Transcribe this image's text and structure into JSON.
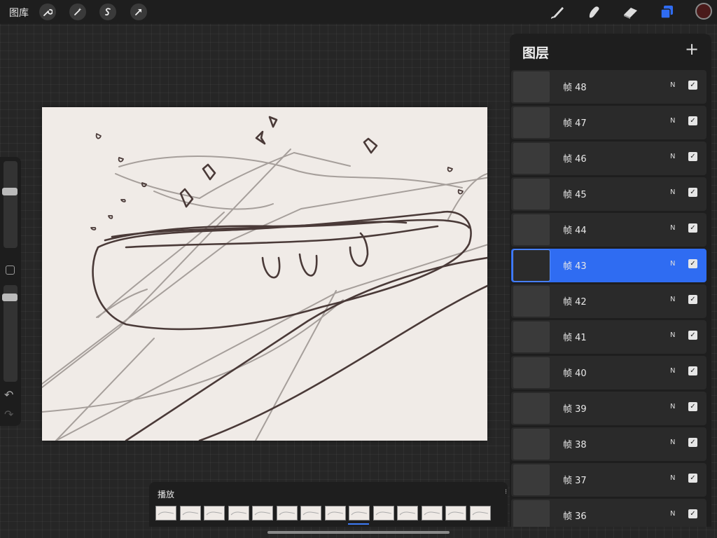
{
  "topbar": {
    "gallery_label": "图库",
    "left_tools": [
      {
        "icon": "wrench-icon"
      },
      {
        "icon": "magic-wand-icon"
      },
      {
        "icon": "selection-icon"
      },
      {
        "icon": "arrow-transform-icon"
      }
    ],
    "right_tools": [
      {
        "icon": "brush-icon"
      },
      {
        "icon": "smudge-icon"
      },
      {
        "icon": "eraser-icon"
      },
      {
        "icon": "layers-icon"
      }
    ],
    "current_color": "#4a1a1a",
    "accent_color": "#2f6cf2"
  },
  "layers_panel": {
    "title": "图层",
    "add_glyph": "+",
    "layers": [
      {
        "name": "帧 48",
        "blend": "N",
        "visible": true,
        "selected": false
      },
      {
        "name": "帧 47",
        "blend": "N",
        "visible": true,
        "selected": false
      },
      {
        "name": "帧 46",
        "blend": "N",
        "visible": true,
        "selected": false
      },
      {
        "name": "帧 45",
        "blend": "N",
        "visible": true,
        "selected": false
      },
      {
        "name": "帧 44",
        "blend": "N",
        "visible": true,
        "selected": false
      },
      {
        "name": "帧 43",
        "blend": "N",
        "visible": true,
        "selected": true
      },
      {
        "name": "帧 42",
        "blend": "N",
        "visible": true,
        "selected": false
      },
      {
        "name": "帧 41",
        "blend": "N",
        "visible": true,
        "selected": false
      },
      {
        "name": "帧 40",
        "blend": "N",
        "visible": true,
        "selected": false
      },
      {
        "name": "帧 39",
        "blend": "N",
        "visible": true,
        "selected": false
      },
      {
        "name": "帧 38",
        "blend": "N",
        "visible": true,
        "selected": false
      },
      {
        "name": "帧 37",
        "blend": "N",
        "visible": true,
        "selected": false
      },
      {
        "name": "帧 36",
        "blend": "N",
        "visible": true,
        "selected": false
      }
    ]
  },
  "timeline": {
    "play_label": "播放",
    "frame_count": 14,
    "current_frame": 9
  },
  "sidebar": {
    "undo_glyph": "↶",
    "redo_glyph": "↷"
  }
}
